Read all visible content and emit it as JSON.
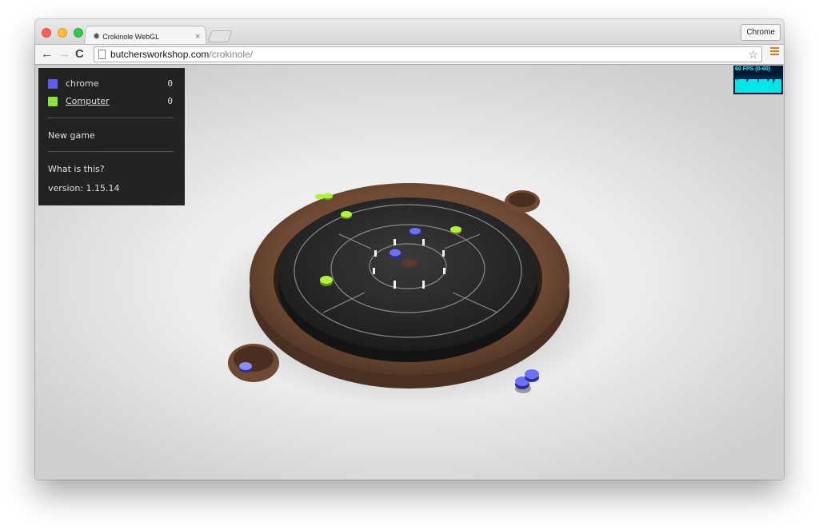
{
  "browser": {
    "tab_title": "Crokinole WebGL",
    "tab_favicon": "gear-icon",
    "tab_close": "×",
    "profile_button": "Chrome",
    "url_host": "butchersworkshop.com",
    "url_path": "/crokinole/",
    "nav": {
      "back": "←",
      "forward": "→",
      "reload": "C",
      "star": "☆"
    }
  },
  "panel": {
    "players": [
      {
        "name": "chrome",
        "score": "0",
        "color": "#5a5ee8"
      },
      {
        "name": "Computer",
        "score": "0",
        "color": "#8fe13c"
      }
    ],
    "new_game": "New game",
    "what_is_this": "What is this?",
    "version": "version: 1.15.14"
  },
  "stats": {
    "fps_label": "60 FPS (0-60)"
  },
  "colors": {
    "blue_disc": "#5a5ee8",
    "green_disc": "#a8f03a",
    "board_wood": "#6e4a34",
    "board_surface": "#2a2a2a",
    "fps_text": "#00ffff"
  }
}
